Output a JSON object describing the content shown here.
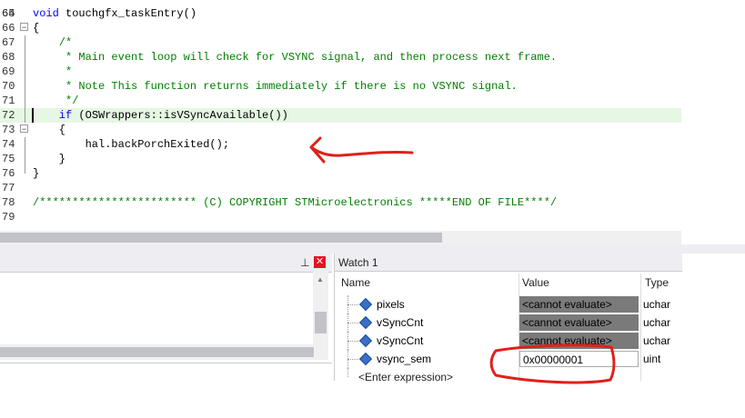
{
  "editor": {
    "lines": [
      {
        "num": "65",
        "parts": [
          {
            "t": "void",
            "c": "kw"
          },
          {
            "t": " touchgfx_taskEntry()",
            "c": ""
          }
        ]
      },
      {
        "num": "66",
        "parts": [
          {
            "t": "{",
            "c": ""
          }
        ]
      },
      {
        "num": "67",
        "parts": [
          {
            "t": "    /*",
            "c": "cm"
          }
        ]
      },
      {
        "num": "68",
        "parts": [
          {
            "t": "     * Main event loop will check for VSYNC signal, and then process next frame.",
            "c": "cm"
          }
        ]
      },
      {
        "num": "69",
        "parts": [
          {
            "t": "     *",
            "c": "cm"
          }
        ]
      },
      {
        "num": "70",
        "parts": [
          {
            "t": "     * Note This function returns immediately if there is no VSYNC signal.",
            "c": "cm"
          }
        ]
      },
      {
        "num": "71",
        "parts": [
          {
            "t": "     */",
            "c": "cm"
          }
        ]
      },
      {
        "num": "72",
        "parts": [
          {
            "t": "    if",
            "c": "kw"
          },
          {
            "t": " (OSWrappers::isVSyncAvailable())",
            "c": ""
          }
        ]
      },
      {
        "num": "73",
        "parts": [
          {
            "t": "    {",
            "c": ""
          }
        ]
      },
      {
        "num": "74",
        "parts": [
          {
            "t": "        hal.backPorchExited();",
            "c": ""
          }
        ]
      },
      {
        "num": "75",
        "parts": [
          {
            "t": "    }",
            "c": ""
          }
        ]
      },
      {
        "num": "76",
        "parts": [
          {
            "t": "}",
            "c": ""
          }
        ]
      },
      {
        "num": "77",
        "parts": [
          {
            "t": "",
            "c": ""
          }
        ]
      },
      {
        "num": "78",
        "parts": [
          {
            "t": "/************************ (C) COPYRIGHT STMicroelectronics *****END OF FILE****/",
            "c": "cm"
          }
        ]
      },
      {
        "num": "79",
        "parts": [
          {
            "t": "",
            "c": ""
          }
        ]
      }
    ]
  },
  "left_panel": {
    "pin_glyph": "⊥",
    "close_glyph": "✕"
  },
  "watch": {
    "title": "Watch 1",
    "columns": {
      "name": "Name",
      "value": "Value",
      "type": "Type"
    },
    "rows": [
      {
        "name": "pixels",
        "value": "<cannot evaluate>",
        "type": "uchar",
        "error": true
      },
      {
        "name": "vSyncCnt",
        "value": "<cannot evaluate>",
        "type": "uchar",
        "error": true
      },
      {
        "name": "vSyncCnt",
        "value": "<cannot evaluate>",
        "type": "uchar",
        "error": true
      },
      {
        "name": "vsync_sem",
        "value": "0x00000001",
        "type": "uint",
        "error": false
      }
    ],
    "enter_expression": "<Enter expression>"
  },
  "colors": {
    "highlight_line": "#e6f7e3",
    "annotation_red": "#e0201a",
    "error_cell": "#7a7a7a"
  }
}
